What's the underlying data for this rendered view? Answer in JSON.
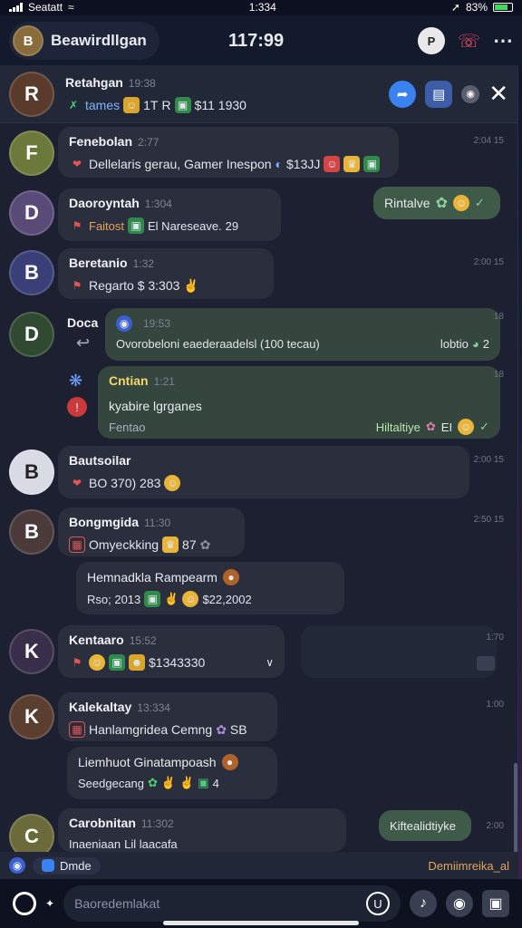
{
  "status_bar": {
    "carrier": "Seatatt",
    "time": "1:334",
    "battery_text": "83%"
  },
  "header": {
    "title": "Beawirdllgan",
    "time": "117:99"
  },
  "pinned": {
    "name": "Retahgan",
    "time": "19:38",
    "line": [
      "tames",
      "1T",
      "R",
      "$11 1930"
    ]
  },
  "messages": [
    {
      "name": "Fenebolan",
      "time": "2:77",
      "text": "Dellelaris gerau, Gamer Inespon",
      "amount": "$13JJ",
      "side_time": "2:04 15"
    },
    {
      "name": "Daoroyntah",
      "time": "1:304",
      "text": "Faitost",
      "extra": "El Nareseave.",
      "count": "29",
      "outgoing": "Rintalve"
    },
    {
      "name": "Beretanio",
      "time": "1:32",
      "text": "Regarto $ 3:303",
      "side_time": "2:00 15"
    },
    {
      "name": "Doca",
      "time": "19:53",
      "text": "Ovorobeloni eaederaadelsl (100 tecau)",
      "trail": "lobtio",
      "count": "2",
      "side_time": "18"
    },
    {
      "name": "Cntian",
      "time": "1:21",
      "text": "kyabire lgrganes",
      "sub": "Fentao",
      "outgoing": "Hiltaltiye",
      "badge": "EI",
      "side_time": "18"
    },
    {
      "name": "Bautsoilar",
      "time": "",
      "text": "BO 370) 283",
      "side_time": "2:00 15"
    },
    {
      "name": "Bongmgida",
      "time": "11:30",
      "text": "Omyeckking",
      "count": "87",
      "side_time": "2:50 15"
    },
    {
      "name": "Hemnadkla Rampearm",
      "time": "",
      "text": "Rso; 2013",
      "amount": "$22,2002"
    },
    {
      "name": "Kentaaro",
      "time": "15:52",
      "amount": "$1343330",
      "side_time": "1:70"
    },
    {
      "name": "Kalekaltay",
      "time": "13:334",
      "text": "Hanlamgridea Cemng",
      "extra": "SB",
      "side_time": "1:00"
    },
    {
      "name": "Liemhuot Ginatampoash",
      "time": "",
      "text": "Seedgecang",
      "extra": "4"
    },
    {
      "name": "Carobnitan",
      "time": "11:302",
      "text": "Inaeniaan",
      "extra": "Lil laacafa",
      "outgoing": "Kiftealidtiyke",
      "side_time": "2:00"
    }
  ],
  "reply_bar": {
    "label": "Dmde",
    "right": "Demiimreika_al"
  },
  "composer": {
    "placeholder": "Baoredemlakat"
  },
  "colors": {
    "accent": "#3a82f0",
    "bubble": "#2b2f3d",
    "outgoing": "#3f5a48"
  }
}
